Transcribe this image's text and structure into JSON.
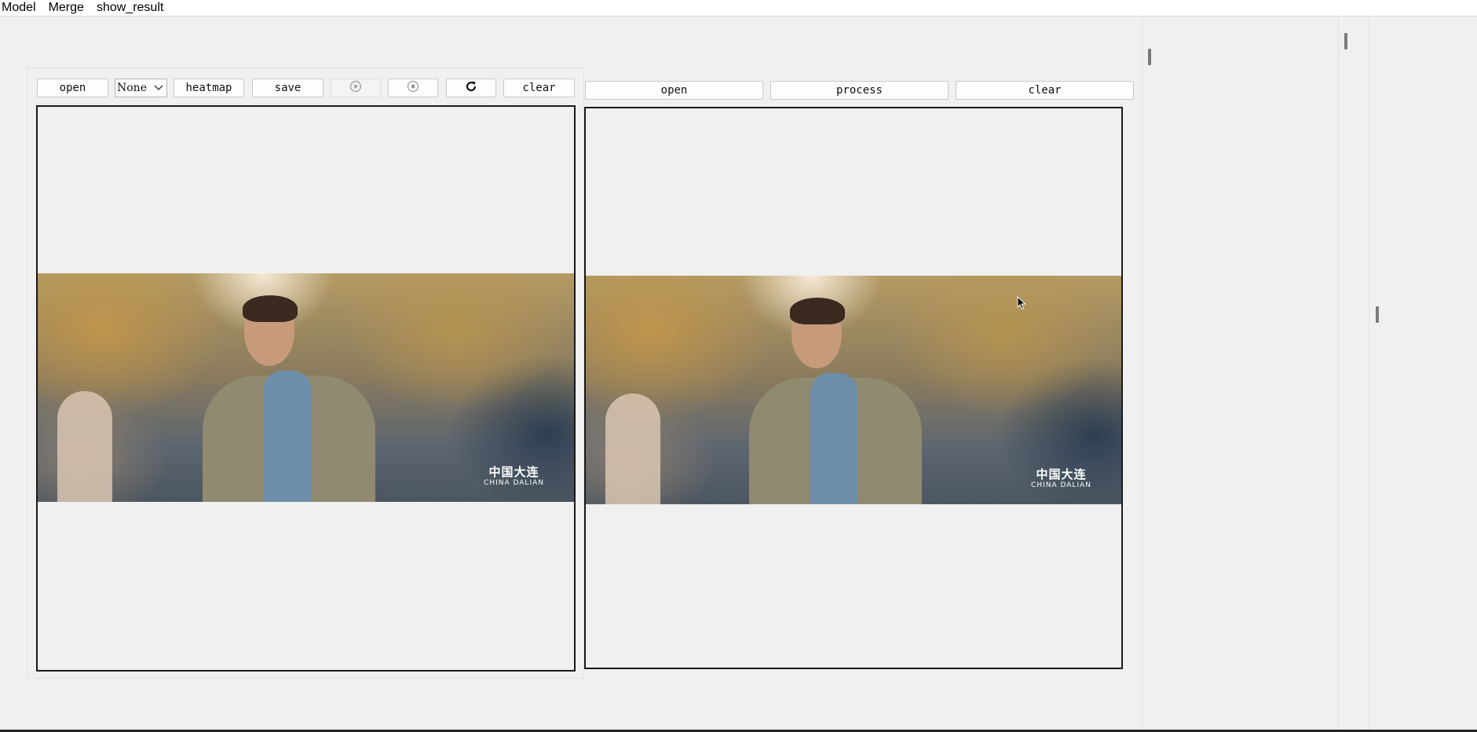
{
  "menubar": {
    "items": [
      "Model",
      "Merge",
      "show_result"
    ]
  },
  "left_toolbar": {
    "open": "open",
    "combo_value": "None",
    "heatmap": "heatmap",
    "save": "save",
    "play_icon": "play-icon",
    "stop_icon": "stop-icon",
    "refresh_icon": "refresh-icon",
    "clear": "clear"
  },
  "right_toolbar": {
    "open": "open",
    "process": "process",
    "clear": "clear"
  },
  "image_watermark": {
    "cn": "中国大连",
    "en": "CHINA DALIAN"
  },
  "colors": {
    "background": "#f0f0f0",
    "border": "#1a1a1a",
    "menubar": "#ffffff"
  }
}
